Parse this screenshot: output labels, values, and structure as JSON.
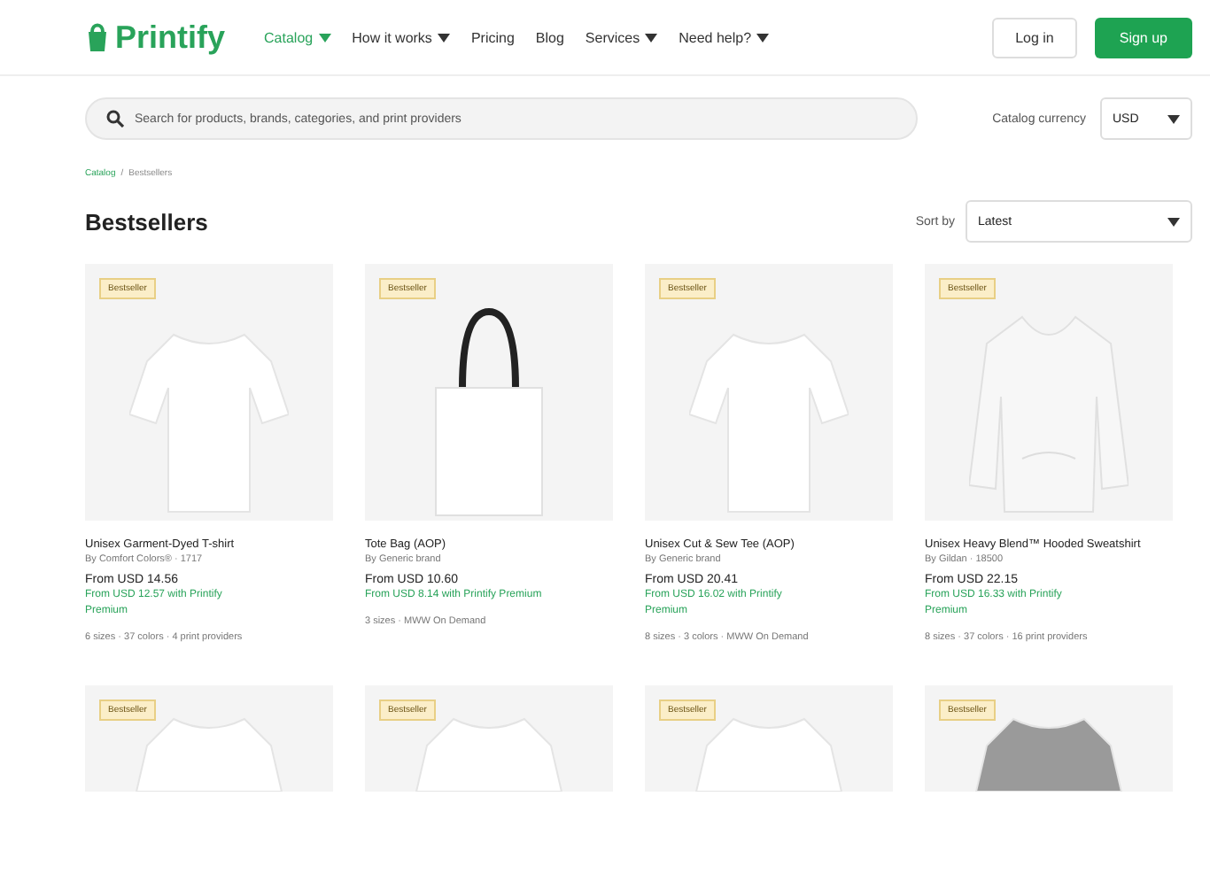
{
  "header": {
    "logo": "Printify",
    "nav": [
      {
        "label": "Catalog",
        "dropdown": true,
        "selected": true
      },
      {
        "label": "How it works",
        "dropdown": true,
        "selected": false
      },
      {
        "label": "Pricing",
        "dropdown": false,
        "selected": false
      },
      {
        "label": "Blog",
        "dropdown": false,
        "selected": false
      },
      {
        "label": "Services",
        "dropdown": true,
        "selected": false
      },
      {
        "label": "Need help?",
        "dropdown": true,
        "selected": false
      }
    ],
    "login": "Log in",
    "signup": "Sign up"
  },
  "search": {
    "placeholder": "Search for products, brands, categories, and print providers"
  },
  "currency": {
    "label": "Catalog currency",
    "value": "USD"
  },
  "breadcrumb": {
    "items": [
      "Catalog",
      "Bestsellers"
    ],
    "separator": "/"
  },
  "title": "Bestsellers",
  "sort": {
    "label": "Sort by",
    "value": "Latest"
  },
  "products": [
    {
      "kind": "tshirt",
      "badge": "Bestseller",
      "name": "Unisex Garment-Dyed T-shirt",
      "brand": "By Comfort Colors® · 1717",
      "price": "From USD 14.56",
      "premium": "From USD 12.57 with Printify Premium",
      "details": "6 sizes · 37 colors · 4 print providers"
    },
    {
      "kind": "bag",
      "badge": "Bestseller",
      "name": "Tote Bag (AOP)",
      "brand": "By Generic brand",
      "price": "From USD 10.60",
      "premium": "From USD 8.14 with Printify Premium",
      "details": "3 sizes · MWW On Demand"
    },
    {
      "kind": "tshirt",
      "badge": "Bestseller",
      "name": "Unisex Cut & Sew Tee (AOP)",
      "brand": "By Generic brand",
      "price": "From USD 20.41",
      "premium": "From USD 16.02 with Printify Premium",
      "details": "8 sizes · 3 colors · MWW On Demand"
    },
    {
      "kind": "hoodie",
      "badge": "Bestseller",
      "name": "Unisex Heavy Blend™ Hooded Sweatshirt",
      "brand": "By Gildan · 18500",
      "price": "From USD 22.15",
      "premium": "From USD 16.33 with Printify Premium",
      "details": "8 sizes · 37 colors · 16 print providers"
    }
  ],
  "more_products": [
    {
      "kind": "tshirt",
      "badge": "Bestseller"
    },
    {
      "kind": "tshirt",
      "badge": "Bestseller"
    },
    {
      "kind": "tshirt",
      "badge": "Bestseller"
    },
    {
      "kind": "grey-tshirt",
      "badge": "Bestseller"
    }
  ]
}
